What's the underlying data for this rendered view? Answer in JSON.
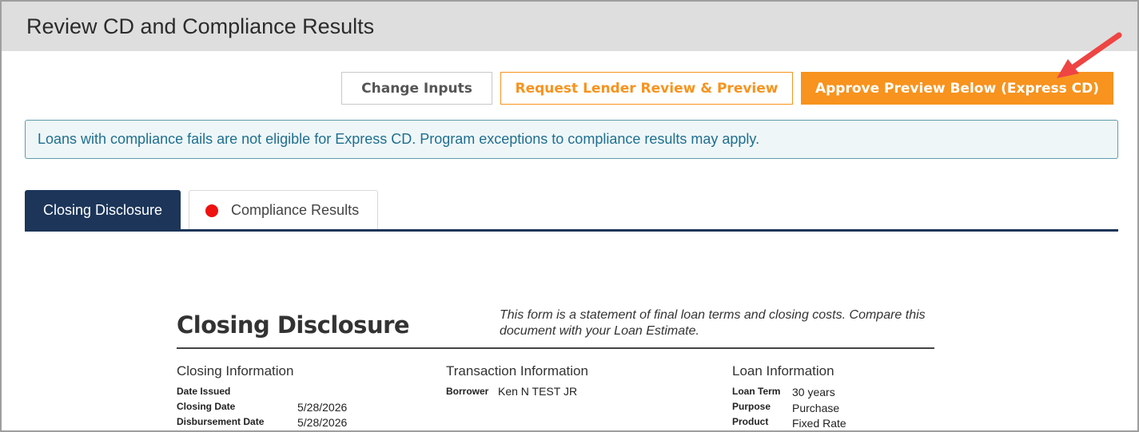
{
  "header": {
    "title": "Review CD and Compliance Results"
  },
  "toolbar": {
    "change_inputs": "Change Inputs",
    "request_review": "Request Lender Review & Preview",
    "approve_preview": "Approve Preview Below (Express CD)"
  },
  "alert": {
    "text": "Loans with compliance fails are not eligible for Express CD. Program exceptions to compliance results may apply."
  },
  "tabs": [
    {
      "label": "Closing Disclosure",
      "active": true
    },
    {
      "label": "Compliance Results",
      "active": false,
      "status_color": "#ee1111"
    }
  ],
  "document": {
    "title": "Closing Disclosure",
    "note": "This form is a statement of final loan terms and closing costs. Compare this document with your Loan Estimate.",
    "closing_info": {
      "heading": "Closing Information",
      "date_issued_label": "Date Issued",
      "date_issued": "",
      "closing_date_label": "Closing Date",
      "closing_date": "5/28/2026",
      "disbursement_date_label": "Disbursement Date",
      "disbursement_date": "5/28/2026"
    },
    "transaction_info": {
      "heading": "Transaction Information",
      "borrower_label": "Borrower",
      "borrower": "Ken N TEST JR"
    },
    "loan_info": {
      "heading": "Loan Information",
      "loan_term_label": "Loan Term",
      "loan_term": "30 years",
      "purpose_label": "Purpose",
      "purpose": "Purchase",
      "product_label": "Product",
      "product": "Fixed Rate"
    }
  },
  "colors": {
    "accent_orange": "#f7931e",
    "navy": "#1c3559",
    "alert_text": "#1f6f8f",
    "annotation_arrow": "#ee4444"
  }
}
